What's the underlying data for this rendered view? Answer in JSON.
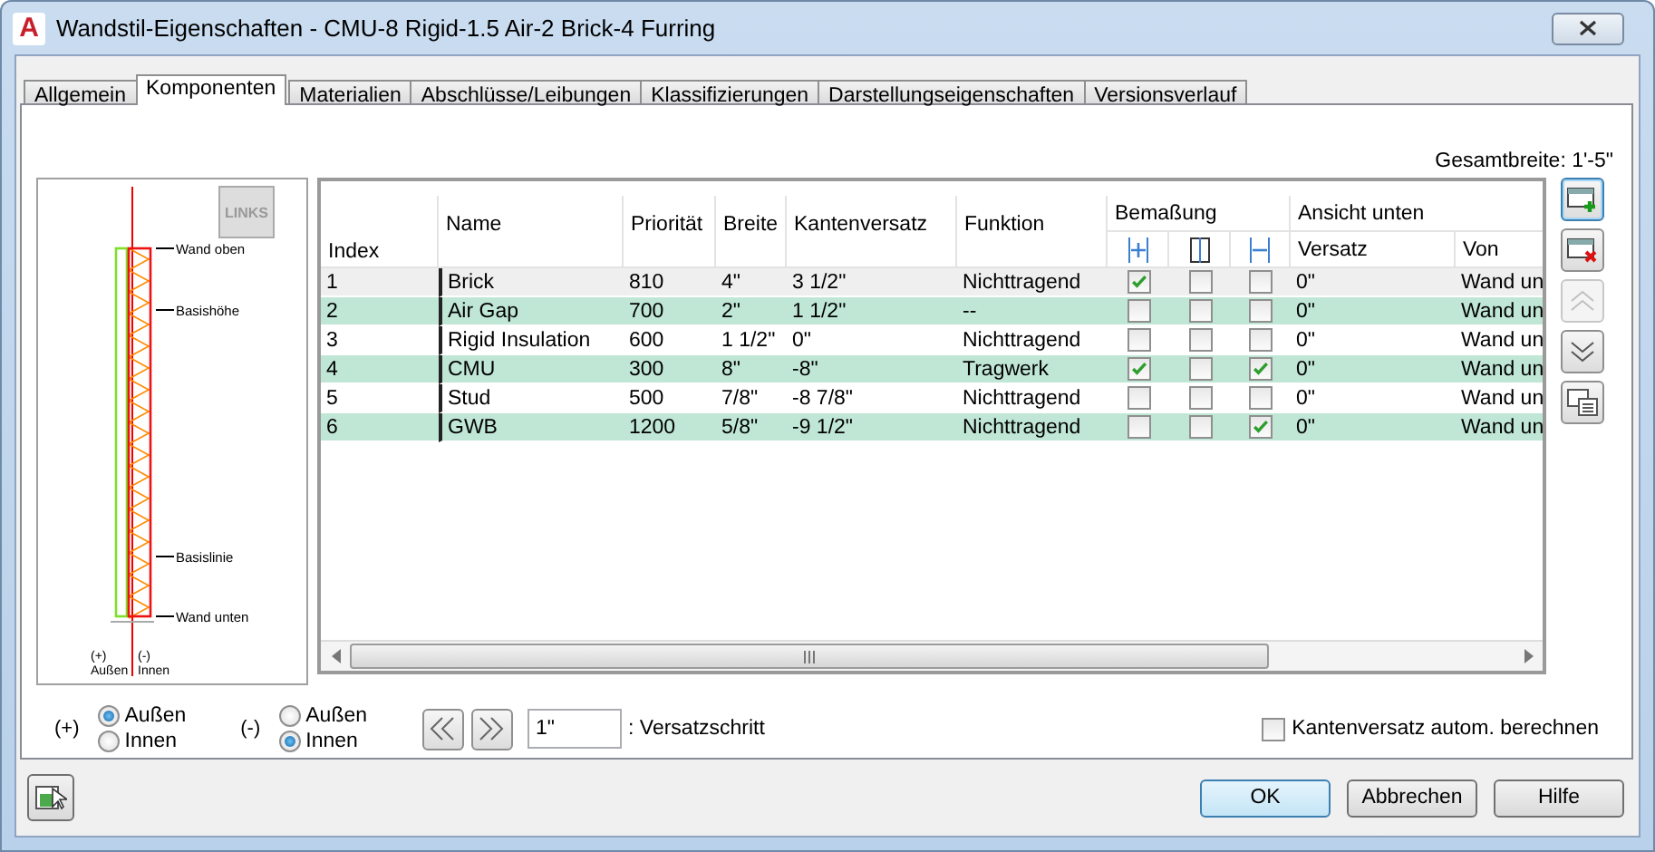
{
  "window": {
    "icon_letter": "A",
    "title": "Wandstil-Eigenschaften - CMU-8 Rigid-1.5 Air-2 Brick-4 Furring"
  },
  "tabs": [
    {
      "label": "Allgemein",
      "selected": false
    },
    {
      "label": "Komponenten",
      "selected": true
    },
    {
      "label": "Materialien",
      "selected": false
    },
    {
      "label": "Abschlüsse/Leibungen",
      "selected": false
    },
    {
      "label": "Klassifizierungen",
      "selected": false
    },
    {
      "label": "Darstellungseigenschaften",
      "selected": false
    },
    {
      "label": "Versionsverlauf",
      "selected": false
    }
  ],
  "total_width": "Gesamtbreite: 1'-5\"",
  "preview": {
    "badge": "LINKS",
    "labels": [
      "Wand oben",
      "Basishöhe",
      "Basislinie",
      "Wand unten"
    ],
    "plus_sign": "(+)",
    "plus_label": "Außen",
    "minus_sign": "(-)",
    "minus_label": "Innen"
  },
  "table": {
    "columns": [
      "Index",
      "Name",
      "Priorität",
      "Breite",
      "Kantenversatz",
      "Funktion"
    ],
    "groups": [
      {
        "label": "Bemaßung"
      },
      {
        "label": "Ansicht unten",
        "columns": [
          "Versatz",
          "Von"
        ]
      }
    ],
    "rows": [
      {
        "index": "1",
        "name": "Brick",
        "priority": "810",
        "width": "4\"",
        "offset": "3 1/2\"",
        "function": "Nichttragend",
        "dimension": [
          true,
          false,
          false
        ],
        "view_offset": "0\"",
        "view_from": "Wand un",
        "selected": true
      },
      {
        "index": "2",
        "name": "Air Gap",
        "priority": "700",
        "width": "2\"",
        "offset": "1 1/2\"",
        "function": "--",
        "dimension": [
          false,
          false,
          false
        ],
        "view_offset": "0\"",
        "view_from": "Wand un",
        "selected": false
      },
      {
        "index": "3",
        "name": "Rigid Insulation",
        "priority": "600",
        "width": "1 1/2\"",
        "offset": "0\"",
        "function": "Nichttragend",
        "dimension": [
          false,
          false,
          false
        ],
        "view_offset": "0\"",
        "view_from": "Wand un",
        "selected": false
      },
      {
        "index": "4",
        "name": "CMU",
        "priority": "300",
        "width": "8\"",
        "offset": "-8\"",
        "function": "Tragwerk",
        "dimension": [
          true,
          false,
          true
        ],
        "view_offset": "0\"",
        "view_from": "Wand un",
        "selected": false
      },
      {
        "index": "5",
        "name": "Stud",
        "priority": "500",
        "width": "7/8\"",
        "offset": "-8 7/8\"",
        "function": "Nichttragend",
        "dimension": [
          false,
          false,
          false
        ],
        "view_offset": "0\"",
        "view_from": "Wand un",
        "selected": false
      },
      {
        "index": "6",
        "name": "GWB",
        "priority": "1200",
        "width": "5/8\"",
        "offset": "-9 1/2\"",
        "function": "Nichttragend",
        "dimension": [
          false,
          false,
          true
        ],
        "view_offset": "0\"",
        "view_from": "Wand un",
        "selected": false
      }
    ]
  },
  "side_buttons": [
    {
      "kind": "add",
      "disabled": false
    },
    {
      "kind": "delete",
      "disabled": false
    },
    {
      "kind": "up",
      "disabled": true
    },
    {
      "kind": "down",
      "disabled": false
    },
    {
      "kind": "detail",
      "disabled": false
    }
  ],
  "side_options": [
    {
      "sign": "(+)",
      "options": [
        {
          "label": "Außen",
          "selected": true
        },
        {
          "label": "Innen",
          "selected": false
        }
      ]
    },
    {
      "sign": "(-)",
      "options": [
        {
          "label": "Außen",
          "selected": false
        },
        {
          "label": "Innen",
          "selected": true
        }
      ]
    }
  ],
  "step": {
    "value": "1\"",
    "label": ": Versatzschritt"
  },
  "auto_offset": {
    "label": "Kantenversatz autom. berechnen",
    "checked": false
  },
  "buttons": [
    {
      "label": "OK",
      "default": true
    },
    {
      "label": "Abbrechen",
      "default": false
    },
    {
      "label": "Hilfe",
      "default": false
    }
  ]
}
